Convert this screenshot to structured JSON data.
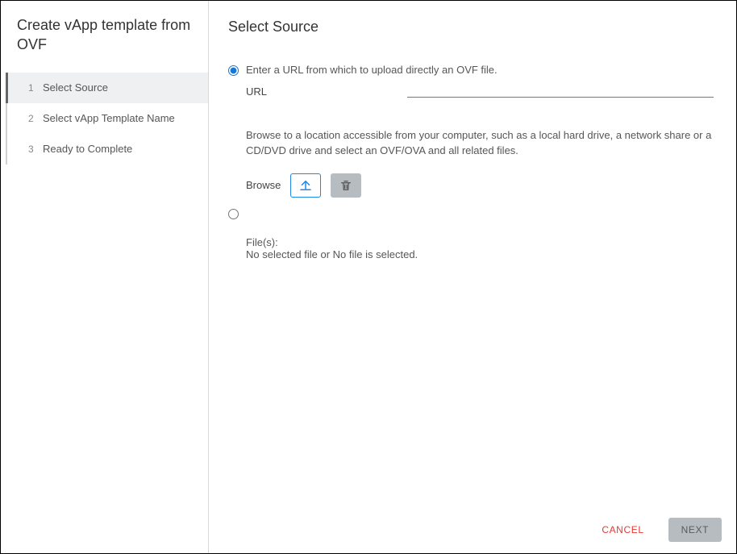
{
  "sidebar": {
    "title": "Create vApp template from OVF",
    "steps": [
      {
        "num": "1",
        "label": "Select Source",
        "active": true
      },
      {
        "num": "2",
        "label": "Select vApp Template Name",
        "active": false
      },
      {
        "num": "3",
        "label": "Ready to Complete",
        "active": false
      }
    ]
  },
  "main": {
    "title": "Select Source",
    "url_option": {
      "description": "Enter a URL from which to upload directly an OVF file.",
      "field_label": "URL",
      "value": ""
    },
    "browse_option": {
      "description": "Browse to a location accessible from your computer, such as a local hard drive, a network share or a CD/DVD drive and select an OVF/OVA and all related files.",
      "label": "Browse"
    },
    "files": {
      "heading": "File(s):",
      "status": "No selected file or No file is selected."
    }
  },
  "footer": {
    "cancel": "CANCEL",
    "next": "NEXT"
  }
}
